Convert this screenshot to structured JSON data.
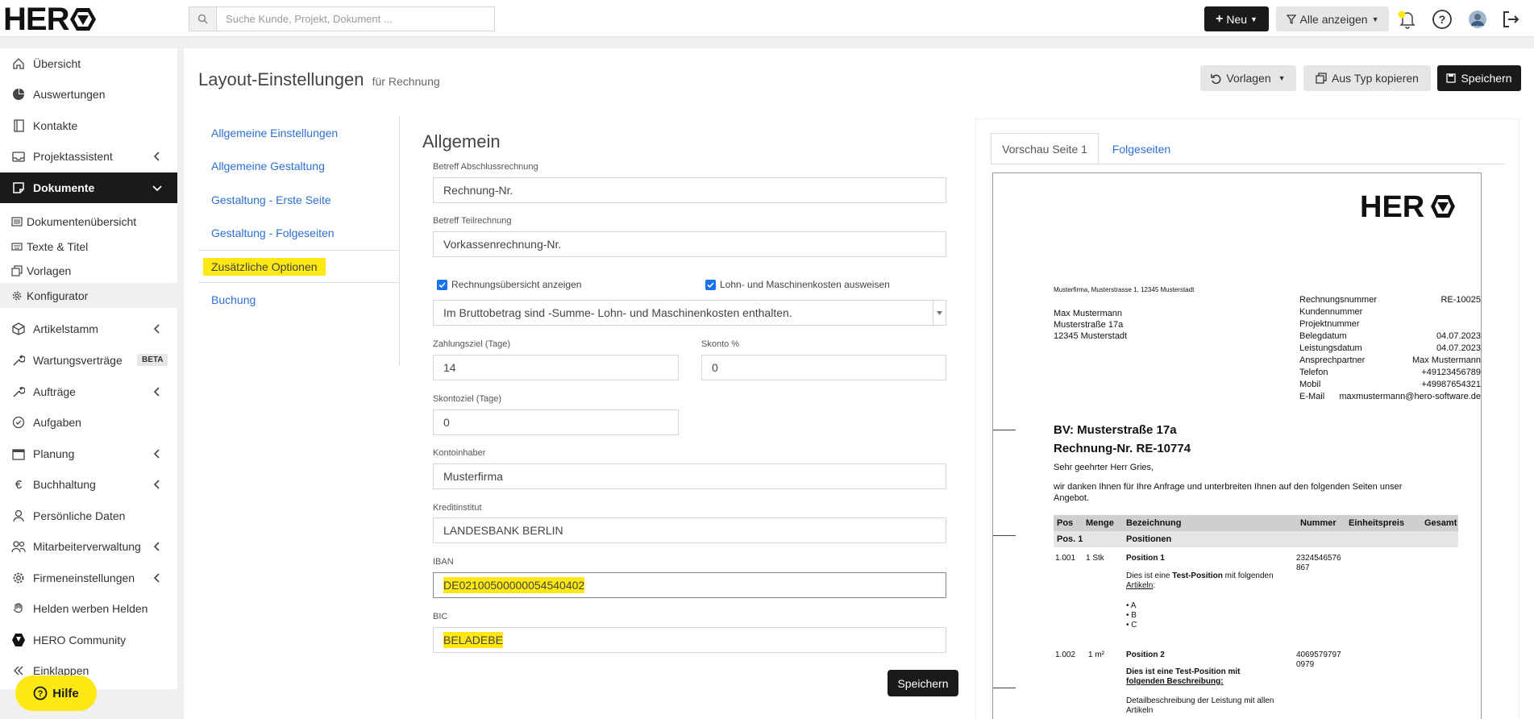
{
  "topbar": {
    "search_placeholder": "Suche Kunde, Projekt, Dokument ...",
    "new_label": "Neu",
    "filter_label": "Alle anzeigen"
  },
  "logo": {
    "text": "HER"
  },
  "sidebar": {
    "items": [
      {
        "label": "Übersicht",
        "icon": "home-icon"
      },
      {
        "label": "Auswertungen",
        "icon": "pie-chart-icon"
      },
      {
        "label": "Kontakte",
        "icon": "address-book-icon"
      },
      {
        "label": "Projektassistent",
        "icon": "inbox-icon"
      },
      {
        "label": "Dokumente",
        "icon": "document-icon"
      },
      {
        "label": "Artikelstamm",
        "icon": "box-icon"
      },
      {
        "label": "Wartungsverträge",
        "icon": "wrench-icon",
        "badge": "BETA"
      },
      {
        "label": "Aufträge",
        "icon": "wrench-icon"
      },
      {
        "label": "Aufgaben",
        "icon": "check-circle-icon"
      },
      {
        "label": "Planung",
        "icon": "calendar-icon"
      },
      {
        "label": "Buchhaltung",
        "icon": "euro-icon"
      },
      {
        "label": "Persönliche Daten",
        "icon": "user-icon"
      },
      {
        "label": "Mitarbeiterverwaltung",
        "icon": "users-icon"
      },
      {
        "label": "Firmeneinstellungen",
        "icon": "gear-icon"
      },
      {
        "label": "Helden werben Helden",
        "icon": "hand-icon"
      },
      {
        "label": "HERO Community",
        "icon": "hero-logo-icon"
      },
      {
        "label": "Einklappen",
        "icon": "collapse-icon"
      }
    ],
    "sub_items": [
      {
        "label": "Dokumentenübersicht"
      },
      {
        "label": "Texte & Titel"
      },
      {
        "label": "Vorlagen"
      },
      {
        "label": "Konfigurator"
      }
    ],
    "help_label": "Hilfe"
  },
  "header": {
    "title": "Layout-Einstellungen",
    "subtitle": "für Rechnung",
    "templates_label": "Vorlagen",
    "copy_label": "Aus Typ kopieren",
    "save_label": "Speichern"
  },
  "subnav": {
    "items": [
      "Allgemeine Einstellungen",
      "Allgemeine Gestaltung",
      "Gestaltung - Erste Seite",
      "Gestaltung - Folgeseiten",
      "Zusätzliche Optionen",
      "Buchung"
    ]
  },
  "form": {
    "section_title": "Allgemein",
    "betreff_abschluss_label": "Betreff Abschlussrechnung",
    "betreff_abschluss_value": "Rechnung-Nr.",
    "betreff_teil_label": "Betreff Teilrechnung",
    "betreff_teil_value": "Vorkassenrechnung-Nr.",
    "chk_uebersicht": "Rechnungsübersicht anzeigen",
    "chk_lohn": "Lohn- und Maschinenkosten ausweisen",
    "select_value": "Im Bruttobetrag sind -Summe- Lohn- und Maschinenkosten enthalten.",
    "zahlungsziel_label": "Zahlungsziel (Tage)",
    "zahlungsziel_value": "14",
    "skonto_label": "Skonto %",
    "skonto_value": "0",
    "skontoziel_label": "Skontoziel (Tage)",
    "skontoziel_value": "0",
    "kontoinhaber_label": "Kontoinhaber",
    "kontoinhaber_value": "Musterfirma",
    "kreditinstitut_label": "Kreditinstitut",
    "kreditinstitut_value": "LANDESBANK BERLIN",
    "iban_label": "IBAN",
    "iban_value": "DE02100500000054540402",
    "bic_label": "BIC",
    "bic_value": "BELADEBE",
    "save_label": "Speichern"
  },
  "preview": {
    "tab1": "Vorschau Seite 1",
    "tab2": "Folgeseiten",
    "sender_line": "Musterfirma, Musterstrasse 1, 12345 Musterstadt",
    "recipient": [
      "Max Mustermann",
      "Musterstraße 17a",
      "12345 Musterstadt"
    ],
    "meta": [
      {
        "k": "Rechnungsnummer",
        "v": "RE-10025"
      },
      {
        "k": "Kundennummer",
        "v": ""
      },
      {
        "k": "Projektnummer",
        "v": ""
      },
      {
        "k": "Belegdatum",
        "v": "04.07.2023"
      },
      {
        "k": "Leistungsdatum",
        "v": "04.07.2023"
      },
      {
        "k": "Ansprechpartner",
        "v": "Max Mustermann"
      },
      {
        "k": "Telefon",
        "v": "+49123456789"
      },
      {
        "k": "Mobil",
        "v": "+49987654321"
      },
      {
        "k": "E-Mail",
        "v": "maxmustermann@hero-software.de"
      }
    ],
    "bv": "BV: Musterstraße 17a",
    "rechnung_nr": "Rechnung-Nr. RE-10774",
    "greeting": "Sehr geehrter Herr Gries,",
    "intro1": "wir danken Ihnen für Ihre Anfrage und unterbreiten Ihnen auf den folgenden Seiten unser",
    "intro2": "Angebot.",
    "table_headers": [
      "Pos",
      "Menge",
      "Bezeichnung",
      "Nummer",
      "Einheitspreis",
      "Gesamt"
    ],
    "section_pos": "Pos. 1",
    "section_name": "Positionen",
    "pos1": {
      "nr": "1.001",
      "menge": "1 Stk",
      "name": "Position 1",
      "nummer1": "2324546576",
      "nummer2": "867",
      "desc_a": "Dies ist eine ",
      "desc_b": "Test-Position",
      "desc_c": " mit folgenden",
      "desc_d": "Artikeln",
      "desc_e": ":",
      "bullets": [
        "A",
        "B",
        "C"
      ]
    },
    "pos2": {
      "nr": "1.002",
      "menge": "1 m²",
      "name": "Position 2",
      "nummer1": "4069579797",
      "nummer2": "0979",
      "desc1": "Dies ist eine Test-Position mit",
      "desc2": "folgenden Beschreibung:",
      "desc3": "Detailbeschreibung der Leistung mit allen",
      "desc4": "Artikeln"
    }
  }
}
